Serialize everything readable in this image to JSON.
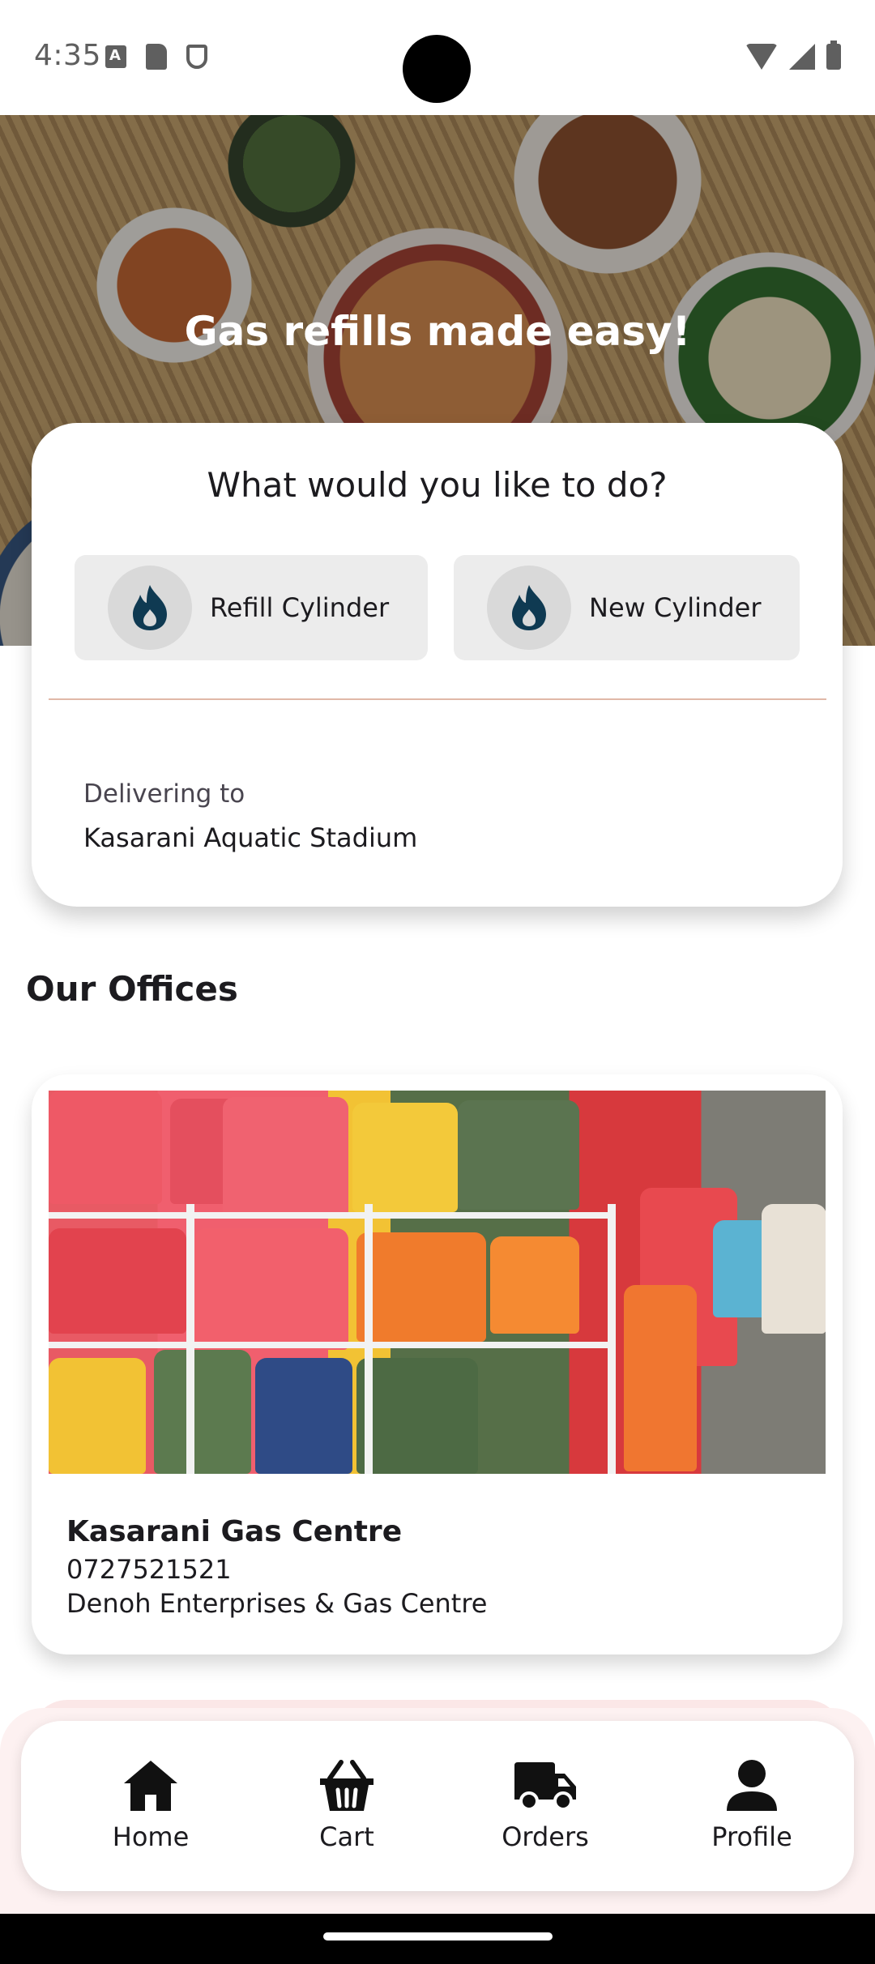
{
  "status_bar": {
    "time": "4:35",
    "icons_left": [
      "a-notification-icon",
      "sd-card-icon",
      "shield-icon"
    ],
    "icons_right": [
      "wifi-icon",
      "signal-icon",
      "battery-icon"
    ]
  },
  "hero": {
    "title": "Gas refills made easy!"
  },
  "action_card": {
    "question": "What would you like to do?",
    "options": [
      {
        "label": "Refill Cylinder",
        "icon": "flame-icon"
      },
      {
        "label": "New Cylinder",
        "icon": "flame-icon"
      }
    ],
    "delivery": {
      "label": "Delivering to",
      "location": "Kasarani Aquatic Stadium"
    }
  },
  "offices": {
    "section_title": "Our Offices",
    "items": [
      {
        "name": "Kasarani Gas Centre",
        "phone": "0727521521",
        "company": "Denoh Enterprises & Gas Centre"
      }
    ]
  },
  "bottom_nav": {
    "items": [
      {
        "label": "Home",
        "icon": "home-icon"
      },
      {
        "label": "Cart",
        "icon": "basket-icon"
      },
      {
        "label": "Orders",
        "icon": "truck-icon"
      },
      {
        "label": "Profile",
        "icon": "person-icon"
      }
    ]
  },
  "colors": {
    "flame_icon": "#0f3a52",
    "option_background": "#ececec",
    "divider": "#e0b8a8",
    "nav_tint": "#fdf1f1"
  }
}
